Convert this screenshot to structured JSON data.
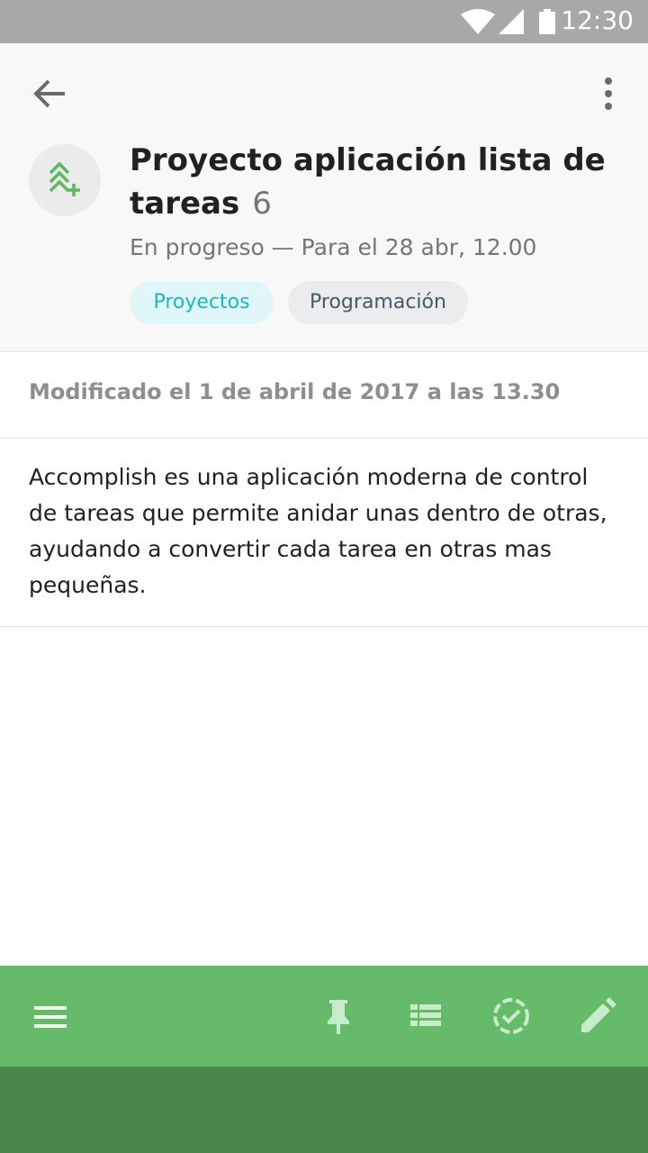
{
  "status_bar": {
    "time": "12:30",
    "icons": [
      "wifi-icon",
      "signal-icon",
      "battery-icon"
    ]
  },
  "header": {
    "back_icon": "arrow-back-icon",
    "menu_icon": "more-vertical-icon",
    "avatar_icon": "nested-tasks-add-icon",
    "title": "Proyecto aplicación lista de tareas",
    "count": "6",
    "subtitle": "En progreso — Para el 28 abr, 12.00",
    "tags": [
      "Proyectos",
      "Programación"
    ]
  },
  "modified": "Modificado el 1 de abril de 2017 a las 13.30",
  "description": "Accomplish es una aplicación moderna de control de tareas que permite anidar unas dentro de otras, ayudando a convertir cada tarea en otras mas pequeñas.",
  "toolbar": {
    "icons": [
      "menu-icon",
      "pin-icon",
      "list-icon",
      "progress-check-icon",
      "edit-icon"
    ]
  },
  "colors": {
    "accent_green": "#66bb6a",
    "nav_green": "#4a874d",
    "tag_cyan_text": "#1eb4c6",
    "tag_cyan_bg": "#e0f7fa"
  }
}
